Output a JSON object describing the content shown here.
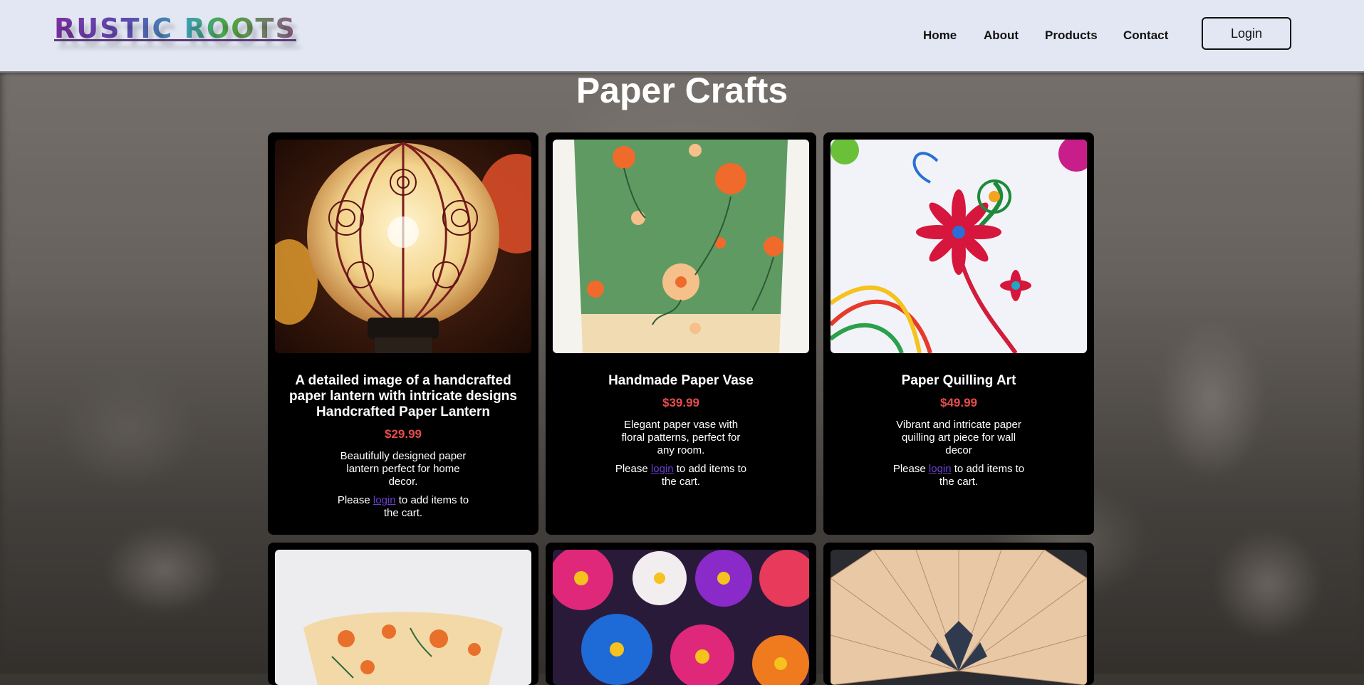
{
  "brand": {
    "logo_text": "RUSTIC ROOTS"
  },
  "nav": {
    "home": "Home",
    "about": "About",
    "products": "Products",
    "contact": "Contact",
    "login_button": "Login"
  },
  "page": {
    "title": "Paper Crafts"
  },
  "products": [
    {
      "name": "A detailed image of a handcrafted paper lantern with intricate designs Handcrafted Paper Lantern",
      "price": "$29.99",
      "description": "Beautifully designed paper lantern perfect for home decor.",
      "note_prefix": "Please ",
      "note_link": "login",
      "note_suffix": " to add items to the cart."
    },
    {
      "name": "Handmade Paper Vase",
      "price": "$39.99",
      "description": "Elegant paper vase with floral patterns, perfect for any room.",
      "note_prefix": "Please ",
      "note_link": "login",
      "note_suffix": " to add items to the cart."
    },
    {
      "name": "Paper Quilling Art",
      "price": "$49.99",
      "description": "Vibrant and intricate paper quilling art piece for wall decor",
      "note_prefix": "Please ",
      "note_link": "login",
      "note_suffix": " to add items to the cart."
    }
  ],
  "colors": {
    "header_bg": "#e3e7f3",
    "card_bg": "#000000",
    "price": "#e74c4c",
    "link": "#6a3fd0"
  }
}
